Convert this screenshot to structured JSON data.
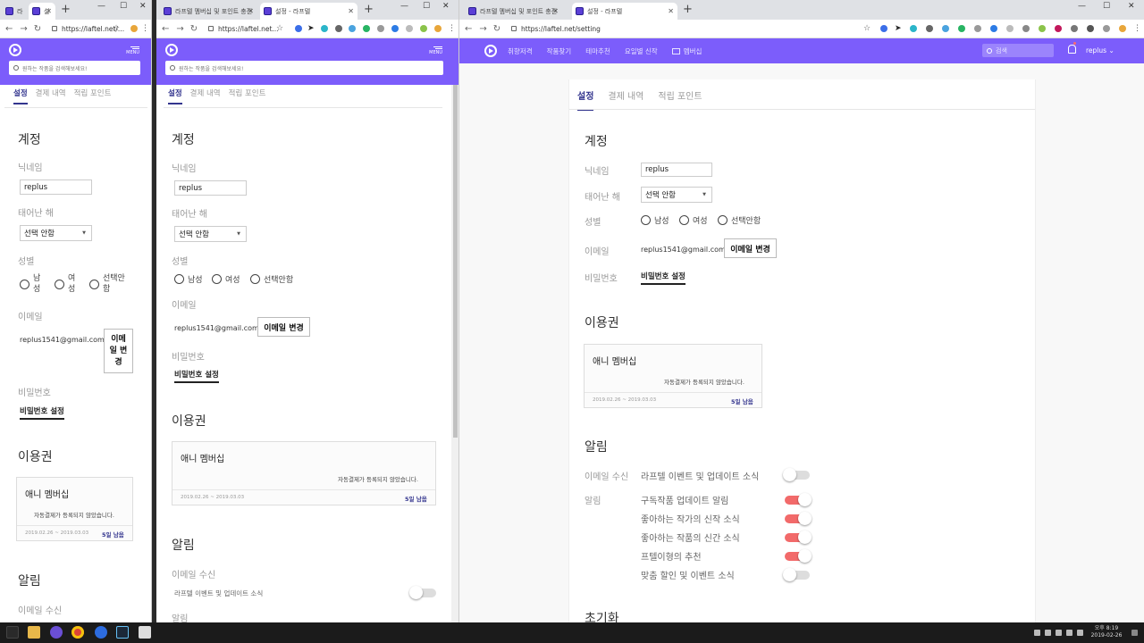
{
  "window1": {
    "tabs": [
      "라",
      "설"
    ],
    "url": "https://laftel.net/..."
  },
  "window2": {
    "tabs": [
      "라프텔 멤버십 및 포인트 충전",
      "설정 - 라프텔"
    ],
    "url": "https://laftel.net..."
  },
  "window3": {
    "tabs": [
      "라프텔 멤버십 및 포인트 충전",
      "설정 - 라프텔"
    ],
    "url": "https://laftel.net/setting",
    "nav": [
      "취향저격",
      "작품찾기",
      "테마추천",
      "요일별 신작",
      "멤버십"
    ],
    "search_placeholder": "검색",
    "username": "replus"
  },
  "mobile": {
    "menu_label": "MENU",
    "search_placeholder": "원하는 작품을 검색해보세요!"
  },
  "settings": {
    "tabs": [
      "설정",
      "결제 내역",
      "적립 포인트"
    ],
    "account_title": "계정",
    "nickname_label": "닉네임",
    "nickname_value": "replus",
    "birth_label": "태어난 해",
    "birth_value": "선택 안함",
    "gender_label": "성별",
    "gender_options": [
      "남성",
      "여성",
      "선택안함"
    ],
    "gender_options_narrow": [
      "남\n성",
      "여\n성",
      "선택안\n함"
    ],
    "email_label": "이메일",
    "email_value": "replus1541@gmail.com",
    "email_change": "이메일 변경",
    "email_change_narrow": "이메\n일 변\n경",
    "password_label": "비밀번호",
    "password_set": "비밀번호 설정",
    "pass_title": "이용권",
    "membership_name": "애니 멤버십",
    "membership_note": "자동결제가 등록되지 않았습니다.",
    "membership_dates": "2019.02.26 ~ 2019.03.03",
    "membership_remaining": "5일 남음",
    "notify_title": "알림",
    "email_receive_label": "이메일 수신",
    "email_receive_text": "라프텔 이벤트 및 업데이트 소식",
    "notify_label": "알림",
    "notify_items": [
      {
        "label": "구독작품 업데이트 알림",
        "on": true
      },
      {
        "label": "좋아하는 작가의 신작 소식",
        "on": true
      },
      {
        "label": "좋아하는 작품의 신간 소식",
        "on": true
      },
      {
        "label": "프텔이형의 추천",
        "on": true
      },
      {
        "label": "맞춤 할인 및 이벤트 소식",
        "on": false
      }
    ],
    "reset_title": "초기화"
  },
  "taskbar": {
    "time": "오후 8:19",
    "date": "2019-02-26"
  },
  "colors": {
    "brand": "#7c5dfb",
    "accent": "#33358e",
    "toggle_on": "#f26a6a"
  }
}
